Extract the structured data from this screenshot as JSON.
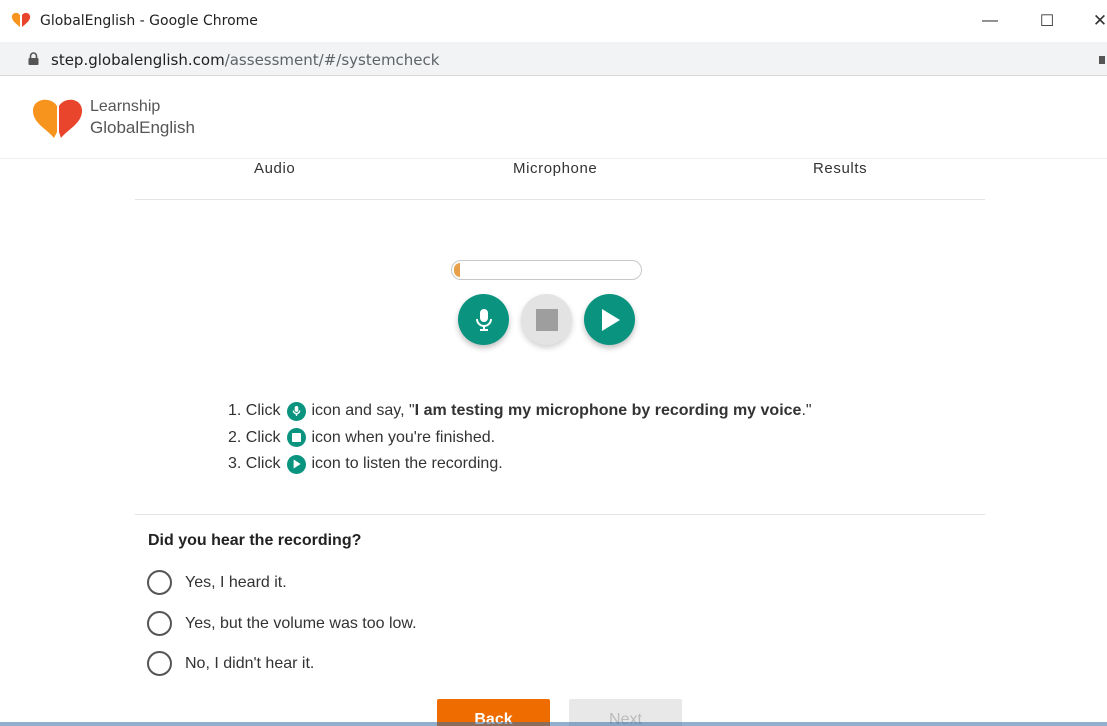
{
  "window": {
    "title": "GlobalEnglish - Google Chrome",
    "minimize_glyph": "—",
    "maximize_glyph": "☐",
    "close_glyph": "✕"
  },
  "address": {
    "host": "step.globalenglish.com",
    "path": "/assessment/#/systemcheck"
  },
  "brand": {
    "line1": "Learnship",
    "line2": "GlobalEnglish",
    "colors": {
      "orange": "#f7941d",
      "red": "#e8452c"
    }
  },
  "steps": [
    {
      "label": "Audio"
    },
    {
      "label": "Microphone"
    },
    {
      "label": "Results"
    }
  ],
  "recorder": {
    "level_fraction": 0.02,
    "buttons": [
      {
        "icon": "microphone-icon",
        "state": "enabled"
      },
      {
        "icon": "stop-icon",
        "state": "disabled"
      },
      {
        "icon": "play-icon",
        "state": "enabled"
      }
    ],
    "accent_color": "#0a9480"
  },
  "instructions": {
    "line1": {
      "prefix": "1. Click",
      "middle": "icon and say, \"",
      "bold": "I am testing my microphone by recording my voice",
      "suffix": ".\""
    },
    "line2": {
      "prefix": "2. Click",
      "suffix": "icon when you're finished."
    },
    "line3": {
      "prefix": "3. Click",
      "suffix": "icon to listen the recording."
    }
  },
  "question": {
    "text": "Did you hear the recording?",
    "options": [
      "Yes, I heard it.",
      "Yes, but the volume was too low.",
      "No, I didn't hear it."
    ]
  },
  "buttons": {
    "back": "Back",
    "next": "Next",
    "back_color": "#ef6c00"
  }
}
